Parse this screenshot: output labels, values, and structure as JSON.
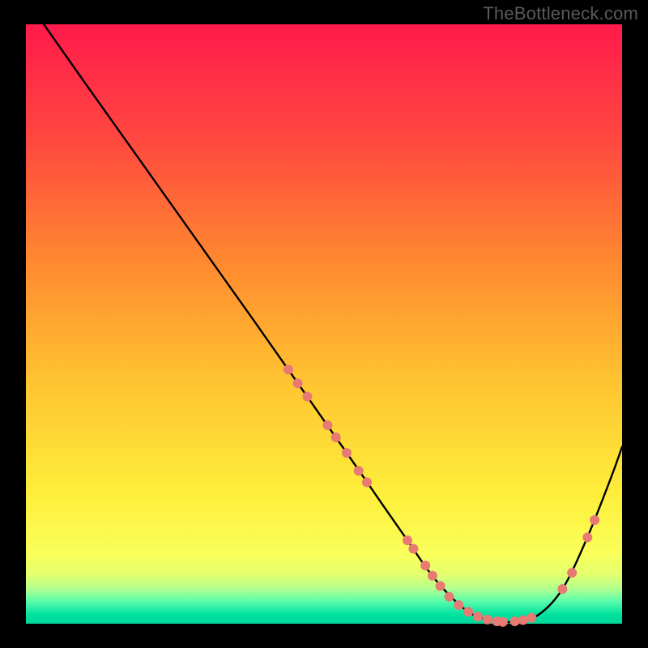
{
  "watermark": "TheBottleneck.com",
  "chart_data": {
    "type": "line",
    "title": "",
    "xlabel": "",
    "ylabel": "",
    "xlim": [
      0,
      100
    ],
    "ylim": [
      0,
      100
    ],
    "grid": false,
    "legend": false,
    "background_gradient": {
      "stops": [
        {
          "offset": 0.0,
          "color": "#ff1a4b"
        },
        {
          "offset": 0.2,
          "color": "#ff4a3f"
        },
        {
          "offset": 0.4,
          "color": "#ff8a2f"
        },
        {
          "offset": 0.6,
          "color": "#ffc531"
        },
        {
          "offset": 0.78,
          "color": "#feed3a"
        },
        {
          "offset": 0.883,
          "color": "#faff59"
        },
        {
          "offset": 0.918,
          "color": "#e3ff6e"
        },
        {
          "offset": 0.941,
          "color": "#b4ff8d"
        },
        {
          "offset": 0.962,
          "color": "#5cfdad"
        },
        {
          "offset": 0.985,
          "color": "#00e29f"
        },
        {
          "offset": 1.0,
          "color": "#00d79a"
        }
      ]
    },
    "series": [
      {
        "name": "bottleneck-curve",
        "color": "#000000",
        "x": [
          3,
          10,
          20,
          30,
          38,
          44,
          50,
          55,
          60,
          64,
          68,
          72,
          75,
          78,
          82,
          86,
          90,
          94,
          98,
          100
        ],
        "y": [
          100,
          90.1,
          76.1,
          62.1,
          50.9,
          42.4,
          33.9,
          26.8,
          19.6,
          13.9,
          8.2,
          3.8,
          1.5,
          0.6,
          0.3,
          1.5,
          5.8,
          14.0,
          24.0,
          29.5
        ]
      }
    ],
    "markers": {
      "name": "highlight-dots",
      "color": "#e77b74",
      "radius_px": 6,
      "points": [
        {
          "x": 44.0,
          "y": 42.4
        },
        {
          "x": 45.6,
          "y": 40.1
        },
        {
          "x": 47.2,
          "y": 37.9
        },
        {
          "x": 50.6,
          "y": 33.1
        },
        {
          "x": 52.0,
          "y": 31.1
        },
        {
          "x": 53.8,
          "y": 28.5
        },
        {
          "x": 55.8,
          "y": 25.5
        },
        {
          "x": 57.2,
          "y": 23.6
        },
        {
          "x": 64.0,
          "y": 13.9
        },
        {
          "x": 65.0,
          "y": 12.5
        },
        {
          "x": 67.0,
          "y": 9.7
        },
        {
          "x": 68.2,
          "y": 8.0
        },
        {
          "x": 69.5,
          "y": 6.3
        },
        {
          "x": 71.0,
          "y": 4.5
        },
        {
          "x": 72.6,
          "y": 3.1
        },
        {
          "x": 74.2,
          "y": 2.0
        },
        {
          "x": 75.8,
          "y": 1.2
        },
        {
          "x": 77.4,
          "y": 0.7
        },
        {
          "x": 79.0,
          "y": 0.4
        },
        {
          "x": 80.0,
          "y": 0.3
        },
        {
          "x": 82.0,
          "y": 0.4
        },
        {
          "x": 83.4,
          "y": 0.6
        },
        {
          "x": 84.8,
          "y": 1.0
        },
        {
          "x": 90.0,
          "y": 5.8
        },
        {
          "x": 91.6,
          "y": 8.5
        },
        {
          "x": 94.2,
          "y": 14.4
        },
        {
          "x": 95.4,
          "y": 17.3
        }
      ]
    }
  }
}
